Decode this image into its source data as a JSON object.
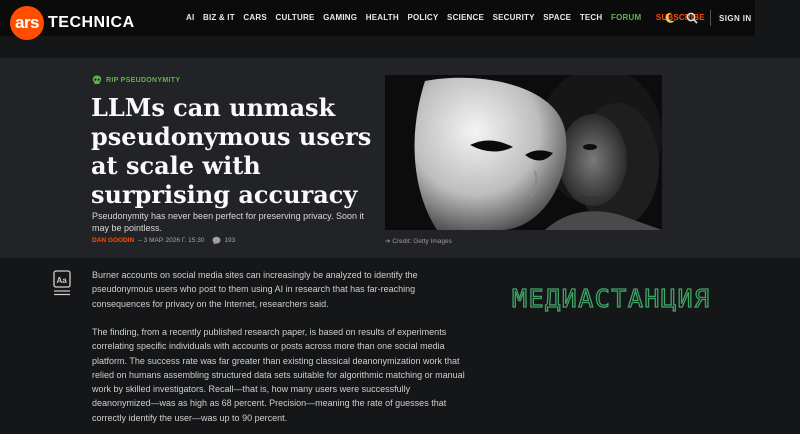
{
  "site": {
    "logo_mark": "ars",
    "logo_word": "TECHNICA",
    "nav": [
      "AI",
      "BIZ & IT",
      "CARS",
      "CULTURE",
      "GAMING",
      "HEALTH",
      "POLICY",
      "SCIENCE",
      "SECURITY",
      "SPACE",
      "TECH"
    ],
    "forum": "FORUM",
    "subscribe": "SUBSCRIBE",
    "signin": "SIGN IN",
    "icons": [
      "moon-icon",
      "search-icon"
    ],
    "colors": {
      "brand": "#ff4e00",
      "forum": "#5fb34a"
    }
  },
  "article": {
    "kicker": "RIP PSEUDONYMITY",
    "title": "LLMs can unmask pseudonymous users at scale with surprising accuracy",
    "dek": "Pseudonymity has never been perfect for preserving privacy. Soon it may be pointless.",
    "author": "DAN GOODIN",
    "date": "– 3 МАР. 2026 Г. 15:30",
    "comments": "193",
    "credit": "Credit: Getty Images",
    "paragraphs": [
      "Burner accounts on social media sites can increasingly be analyzed to identify the pseudonymous users who post to them using AI in research that has far-reaching consequences for privacy on the Internet, researchers said.",
      "The finding, from a recently published research paper, is based on results of experiments correlating specific individuals with accounts or posts across more than one social media platform. The success rate was far greater than existing classical deanonymization work that relied on humans assembling structured data sets suitable for algorithmic matching or manual work by skilled investigators. Recall—that is, how many users were successfully deanonymized—was as high as 68 percent. Precision—meaning the rate of guesses that correctly identify the user—was up to 90 percent."
    ]
  },
  "watermark": "МЕДИАСТАНЦИЯ"
}
